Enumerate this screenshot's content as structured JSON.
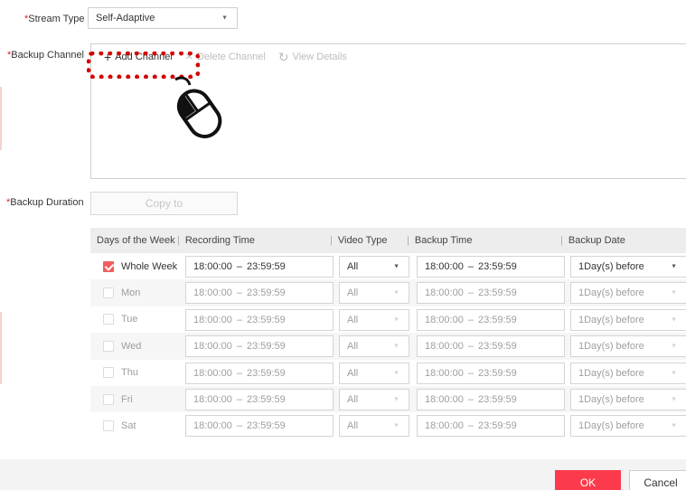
{
  "stream_type": {
    "label": "Stream Type",
    "value": "Self-Adaptive"
  },
  "backup_channel": {
    "label": "Backup Channel",
    "toolbar": {
      "add": "Add Channel",
      "delete": "Delete Channel",
      "view": "View Details"
    }
  },
  "backup_duration": {
    "label": "Backup Duration",
    "copy_label": "Copy to"
  },
  "table": {
    "headers": {
      "days": "Days of the Week",
      "recording": "Recording Time",
      "video": "Video Type",
      "backup_time": "Backup Time",
      "backup_date": "Backup Date"
    },
    "rows": [
      {
        "day": "Whole Week",
        "checked": true,
        "rec_start": "18:00:00",
        "rec_end": "23:59:59",
        "video": "All",
        "bk_start": "18:00:00",
        "bk_end": "23:59:59",
        "date": "1Day(s) before"
      },
      {
        "day": "Mon",
        "checked": false,
        "rec_start": "18:00:00",
        "rec_end": "23:59:59",
        "video": "All",
        "bk_start": "18:00:00",
        "bk_end": "23:59:59",
        "date": "1Day(s) before"
      },
      {
        "day": "Tue",
        "checked": false,
        "rec_start": "18:00:00",
        "rec_end": "23:59:59",
        "video": "All",
        "bk_start": "18:00:00",
        "bk_end": "23:59:59",
        "date": "1Day(s) before"
      },
      {
        "day": "Wed",
        "checked": false,
        "rec_start": "18:00:00",
        "rec_end": "23:59:59",
        "video": "All",
        "bk_start": "18:00:00",
        "bk_end": "23:59:59",
        "date": "1Day(s) before"
      },
      {
        "day": "Thu",
        "checked": false,
        "rec_start": "18:00:00",
        "rec_end": "23:59:59",
        "video": "All",
        "bk_start": "18:00:00",
        "bk_end": "23:59:59",
        "date": "1Day(s) before"
      },
      {
        "day": "Fri",
        "checked": false,
        "rec_start": "18:00:00",
        "rec_end": "23:59:59",
        "video": "All",
        "bk_start": "18:00:00",
        "bk_end": "23:59:59",
        "date": "1Day(s) before"
      },
      {
        "day": "Sat",
        "checked": false,
        "rec_start": "18:00:00",
        "rec_end": "23:59:59",
        "video": "All",
        "bk_start": "18:00:00",
        "bk_end": "23:59:59",
        "date": "1Day(s) before"
      }
    ]
  },
  "footer": {
    "ok": "OK",
    "cancel": "Cancel"
  },
  "colors": {
    "accent": "#fb3b4c",
    "highlight": "#d40000",
    "checkbox": "#f25c5c"
  },
  "icons": {
    "add": "plus-icon",
    "delete": "delete-icon",
    "view": "refresh-icon",
    "pointer": "mouse-icon"
  }
}
